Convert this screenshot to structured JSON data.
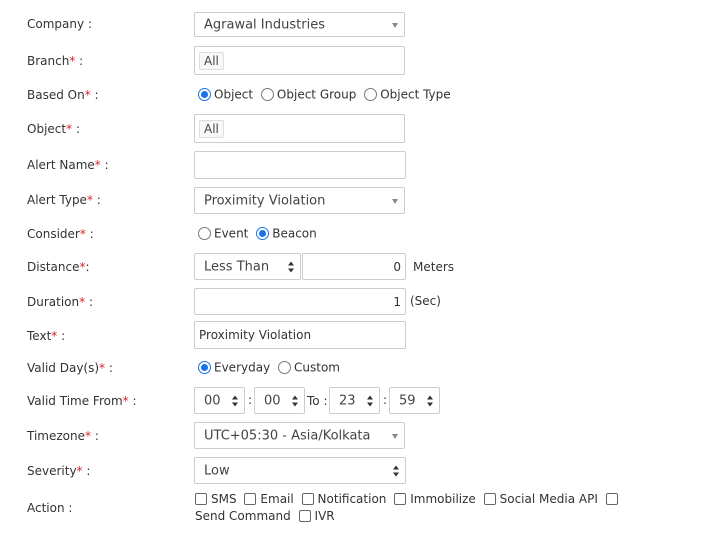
{
  "company": {
    "label": "Company :",
    "value": "Agrawal Industries"
  },
  "branch": {
    "label": "Branch",
    "req": "*",
    "colon": " :",
    "value": "All"
  },
  "based_on": {
    "label": "Based On",
    "req": "*",
    "colon": " :",
    "options": [
      "Object",
      "Object Group",
      "Object Type"
    ],
    "selected": "Object"
  },
  "object": {
    "label": "Object",
    "req": "*",
    "colon": " :",
    "value": "All"
  },
  "alert_name": {
    "label": "Alert Name",
    "req": "*",
    "colon": " :",
    "value": ""
  },
  "alert_type": {
    "label": "Alert Type",
    "req": "*",
    "colon": " :",
    "value": "Proximity Violation"
  },
  "consider": {
    "label": "Consider",
    "req": "*",
    "colon": " :",
    "options": [
      "Event",
      "Beacon"
    ],
    "selected": "Beacon"
  },
  "distance": {
    "label": "Distance",
    "req": "*",
    "colon": ":",
    "operator": "Less Than",
    "value": "0",
    "unit": "Meters"
  },
  "duration": {
    "label": "Duration",
    "req": "*",
    "colon": " :",
    "value": "1",
    "unit": "(Sec)"
  },
  "text": {
    "label": "Text",
    "req": "*",
    "colon": " :",
    "value": "Proximity Violation"
  },
  "valid_days": {
    "label": "Valid Day(s)",
    "req": "*",
    "colon": " :",
    "options": [
      "Everyday",
      "Custom"
    ],
    "selected": "Everyday"
  },
  "valid_time": {
    "label": "Valid Time From",
    "req": "*",
    "colon": " :",
    "from_hh": "00",
    "from_mm": "00",
    "sep": ":",
    "to": "To :",
    "to_hh": "23",
    "to_mm": "59"
  },
  "timezone": {
    "label": "Timezone",
    "req": "*",
    "colon": " :",
    "value": "UTC+05:30 - Asia/Kolkata"
  },
  "severity": {
    "label": "Severity",
    "req": "*",
    "colon": " :",
    "value": "Low"
  },
  "action": {
    "label": "Action :",
    "options": [
      "SMS",
      "Email",
      "Notification",
      "Immobilize",
      "Social Media API",
      "Send Command",
      "IVR"
    ]
  },
  "colors": {
    "required": "#d9232d",
    "radio_accent": "#1a73e8",
    "border": "#cccccc"
  }
}
